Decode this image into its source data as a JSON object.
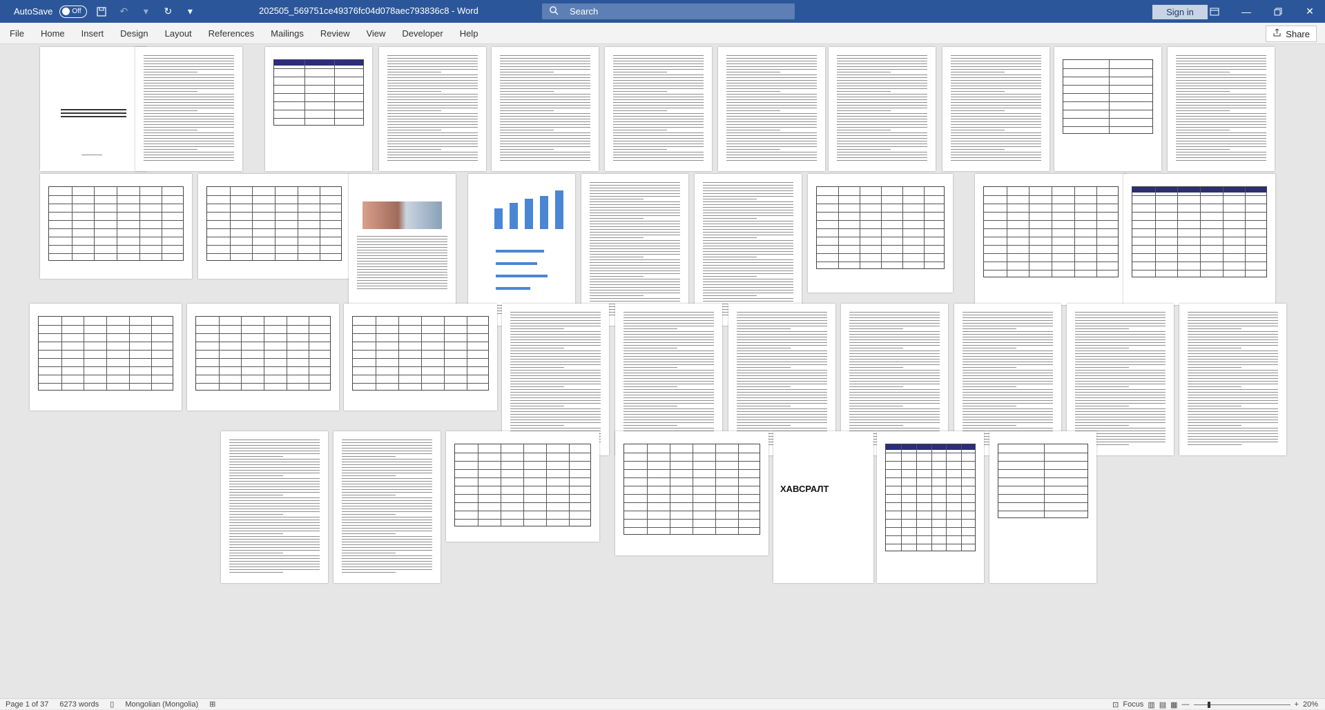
{
  "titlebar": {
    "autosave_label": "AutoSave",
    "autosave_state": "Off",
    "document_title": "202505_569751ce49376fc04d078aec793836c8  -  Word",
    "search_placeholder": "Search",
    "signin_label": "Sign in"
  },
  "menu": {
    "items": [
      "File",
      "Home",
      "Insert",
      "Design",
      "Layout",
      "References",
      "Mailings",
      "Review",
      "View",
      "Developer",
      "Help"
    ],
    "share_label": "Share"
  },
  "document": {
    "big_text_page32": "ХАВСРАЛТ"
  },
  "statusbar": {
    "page_info": "Page 1 of 37",
    "word_count": "6273 words",
    "language": "Mongolian (Mongolia)",
    "focus_label": "Focus",
    "zoom_level": "20%"
  },
  "colors": {
    "titlebar": "#2b579a",
    "table_header": "#2b2d7a",
    "chart_bar": "#4a86d4"
  }
}
